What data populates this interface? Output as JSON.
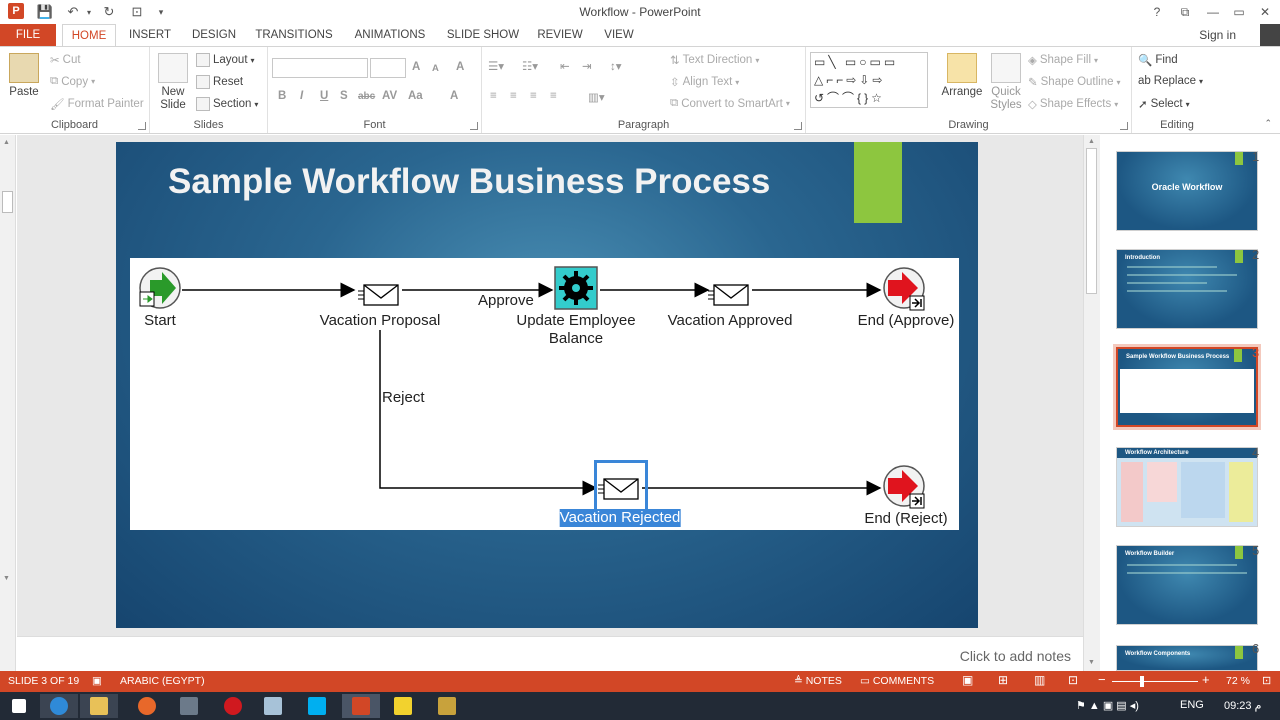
{
  "window": {
    "title": "Workflow - PowerPoint",
    "signin": "Sign in"
  },
  "titlebar": {
    "help": "?",
    "restore": "⧉",
    "minimize": "—",
    "maximize": "▭",
    "close": "✕"
  },
  "tabs": [
    "FILE",
    "HOME",
    "INSERT",
    "DESIGN",
    "TRANSITIONS",
    "ANIMATIONS",
    "SLIDE SHOW",
    "REVIEW",
    "VIEW"
  ],
  "active_tab": "HOME",
  "ribbon": {
    "clipboard": {
      "label": "Clipboard",
      "paste": "Paste",
      "cut": "Cut",
      "copy": "Copy",
      "format_painter": "Format Painter"
    },
    "slides": {
      "label": "Slides",
      "new_slide": "New Slide",
      "layout": "Layout",
      "reset": "Reset",
      "section": "Section"
    },
    "font": {
      "label": "Font",
      "bold": "B",
      "italic": "I",
      "underline": "U",
      "shadow": "S",
      "strike": "abc",
      "spacing": "AV",
      "case": "Aa",
      "grow": "A",
      "shrink": "A",
      "clear": "A",
      "color": "A"
    },
    "paragraph": {
      "label": "Paragraph",
      "text_direction": "Text Direction",
      "align_text": "Align Text",
      "convert": "Convert to SmartArt"
    },
    "drawing": {
      "label": "Drawing",
      "shapes_glyphs": "▭╲ ▭○▭▭ △⌐⌐⇨⇩⇨ ↺⌒⌒{}☆",
      "arrange": "Arrange",
      "quick_styles": "Quick Styles",
      "shape_fill": "Shape Fill",
      "shape_outline": "Shape Outline",
      "shape_effects": "Shape Effects"
    },
    "editing": {
      "label": "Editing",
      "find": "Find",
      "replace": "Replace",
      "select": "Select"
    }
  },
  "slide": {
    "title": "Sample Workflow Business Process",
    "nodes": {
      "start": "Start",
      "vacation_proposal": "Vacation Proposal",
      "update_employee": "Update Employee",
      "balance": "Balance",
      "vacation_approved": "Vacation Approved",
      "end_approve": "End (Approve)",
      "vacation_rejected": "Vacation Rejected",
      "end_reject": "End (Reject)"
    },
    "edges": {
      "approve": "Approve",
      "reject": "Reject"
    }
  },
  "notes": {
    "placeholder": "Click to add notes"
  },
  "thumbnails": [
    {
      "num": "1",
      "title": "Oracle Workflow"
    },
    {
      "num": "2",
      "title": "Introduction"
    },
    {
      "num": "3",
      "title": "Sample Workflow Business Process"
    },
    {
      "num": "4",
      "title": "Workflow Architecture"
    },
    {
      "num": "5",
      "title": "Workflow Builder"
    },
    {
      "num": "6",
      "title": "Workflow Components"
    }
  ],
  "selected_slide": 3,
  "statusbar": {
    "slide_info": "SLIDE 3 OF 19",
    "language": "ARABIC (EGYPT)",
    "notes": "NOTES",
    "comments": "COMMENTS",
    "zoom": "72 %",
    "zoom_level_percent": 72
  },
  "taskbar": {
    "lang": "ENG",
    "time": "09:23",
    "ampm": "م"
  },
  "colors": {
    "accent": "#d24726",
    "slide_green": "#8dc63f",
    "selection": "#3a86d8",
    "slide_bg": "#1d5783"
  }
}
